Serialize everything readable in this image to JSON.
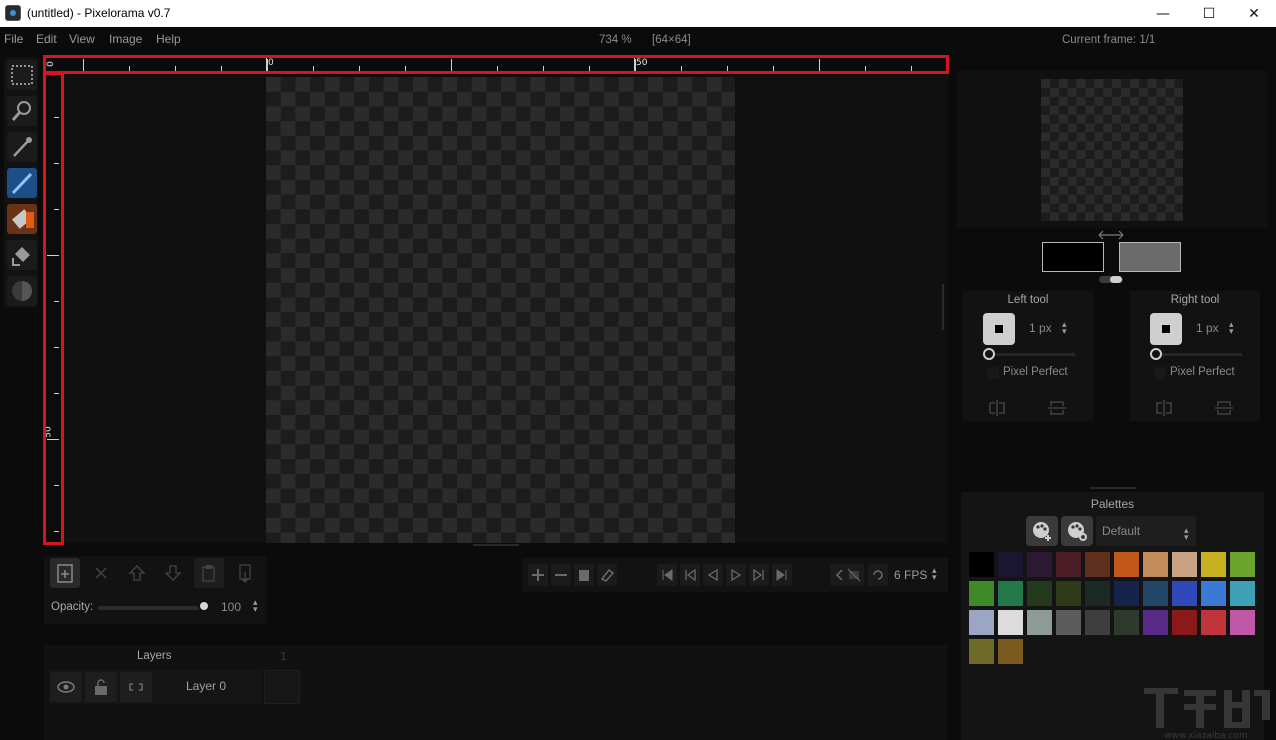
{
  "window": {
    "title": "(untitled) - Pixelorama v0.7",
    "minimize": "—",
    "maximize": "☐",
    "close": "✕"
  },
  "menu": [
    "File",
    "Edit",
    "View",
    "Image",
    "Help"
  ],
  "status": {
    "zoom": "734 %",
    "size": "[64×64]",
    "current_frame": "Current frame: 1/1"
  },
  "rulers": {
    "h_labels": [
      "0",
      "0",
      "50"
    ],
    "v_labels": [
      "50"
    ]
  },
  "tools": [
    "rect-select",
    "zoom",
    "color-picker",
    "pencil",
    "eraser",
    "bucket",
    "lighten-darken"
  ],
  "active_tool": "pencil",
  "layer_toolbar": {
    "opacity_label": "Opacity:",
    "opacity_value": "100",
    "opacity_fraction": 1.0
  },
  "animation": {
    "fps": "6 FPS"
  },
  "layers": {
    "title": "Layers",
    "frame_column": "1",
    "items": [
      {
        "name": "Layer 0"
      }
    ]
  },
  "colors": {
    "left": "#000000",
    "right": "#6b6b6b"
  },
  "left_tool": {
    "title": "Left tool",
    "size": "1 px",
    "pixel_perfect": "Pixel Perfect"
  },
  "right_tool": {
    "title": "Right tool",
    "size": "1 px",
    "pixel_perfect": "Pixel Perfect"
  },
  "palettes": {
    "title": "Palettes",
    "selected": "Default",
    "swatches": [
      "#000000",
      "#1a1530",
      "#2c1830",
      "#4b1d26",
      "#5e2f1c",
      "#c2571b",
      "#c48b5a",
      "#c9a283",
      "#c8b120",
      "#6aa42c",
      "#3f8a26",
      "#22784a",
      "#253a1c",
      "#2f3a18",
      "#1c2a24",
      "#16234a",
      "#214868",
      "#3048b8",
      "#3a7ad6",
      "#3ea0b4",
      "#9aa6c4",
      "#dcdcdc",
      "#8c9b94",
      "#5c5c5c",
      "#3e3e3e",
      "#2e3a2c",
      "#5a2a88",
      "#8a1a1a",
      "#c0343c",
      "#c058a8",
      "#6e6a2a",
      "#7a5a1e"
    ]
  },
  "watermark": {
    "site": "www.xiazaiba.com"
  }
}
